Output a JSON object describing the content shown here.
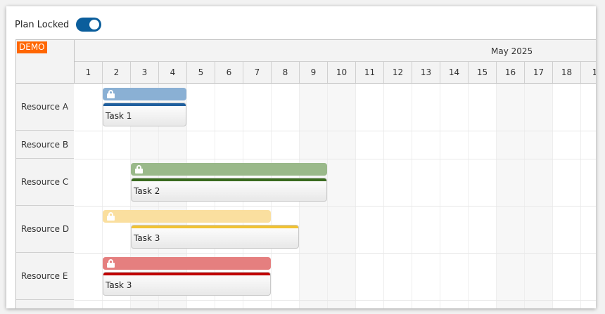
{
  "toolbar": {
    "plan_locked_label": "Plan Locked",
    "plan_locked_on": true
  },
  "demo_badge": "DEMO",
  "month_label": "May 2025",
  "days": [
    "1",
    "2",
    "3",
    "4",
    "5",
    "6",
    "7",
    "8",
    "9",
    "10",
    "11",
    "12",
    "13",
    "14",
    "15",
    "16",
    "17",
    "18",
    "1"
  ],
  "resources": [
    "Resource A",
    "Resource B",
    "Resource C",
    "Resource D",
    "Resource E"
  ],
  "lock_icon": "lock-icon",
  "colors": {
    "blue_bar": "#8ab0d4",
    "blue_line": "#1f5f9e",
    "green_bar": "#9ab98a",
    "green_line": "#3a6b1f",
    "yellow_bar": "#fadf9f",
    "yellow_line": "#f1c232",
    "red_bar": "#e57f7f",
    "red_line": "#c00000"
  },
  "tasks": [
    {
      "name": "Task 1"
    },
    {
      "name": "Task 2"
    },
    {
      "name": "Task 3"
    },
    {
      "name": "Task 3"
    }
  ]
}
